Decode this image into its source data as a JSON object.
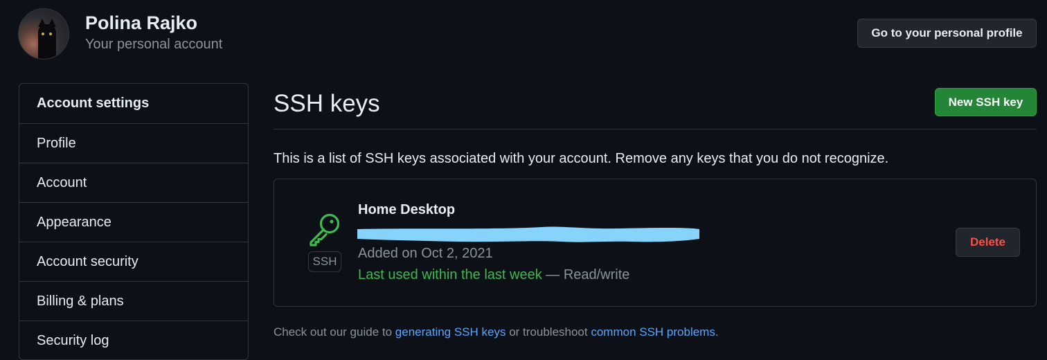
{
  "profile": {
    "name": "Polina Rajko",
    "subtitle": "Your personal account",
    "go_to_profile_label": "Go to your personal profile"
  },
  "sidebar": {
    "heading": "Account settings",
    "items": [
      {
        "label": "Profile"
      },
      {
        "label": "Account"
      },
      {
        "label": "Appearance"
      },
      {
        "label": "Account security"
      },
      {
        "label": "Billing & plans"
      },
      {
        "label": "Security log"
      }
    ]
  },
  "main": {
    "title": "SSH keys",
    "new_key_label": "New SSH key",
    "description": "This is a list of SSH keys associated with your account. Remove any keys that you do not recognize.",
    "key": {
      "title": "Home Desktop",
      "badge": "SSH",
      "added": "Added on Oct 2, 2021",
      "last_used": "Last used within the last week",
      "access": " — Read/write",
      "delete_label": "Delete",
      "icon": "key-icon"
    },
    "footer": {
      "prefix": "Check out our guide to ",
      "link1": "generating SSH keys",
      "middle": " or troubleshoot ",
      "link2": "common SSH problems",
      "suffix": "."
    }
  },
  "colors": {
    "background": "#0d1117",
    "border": "#30363d",
    "primary_button": "#238636",
    "danger": "#f85149",
    "success": "#3fb950",
    "link": "#58a6ff",
    "redaction": "#86d3fb"
  }
}
